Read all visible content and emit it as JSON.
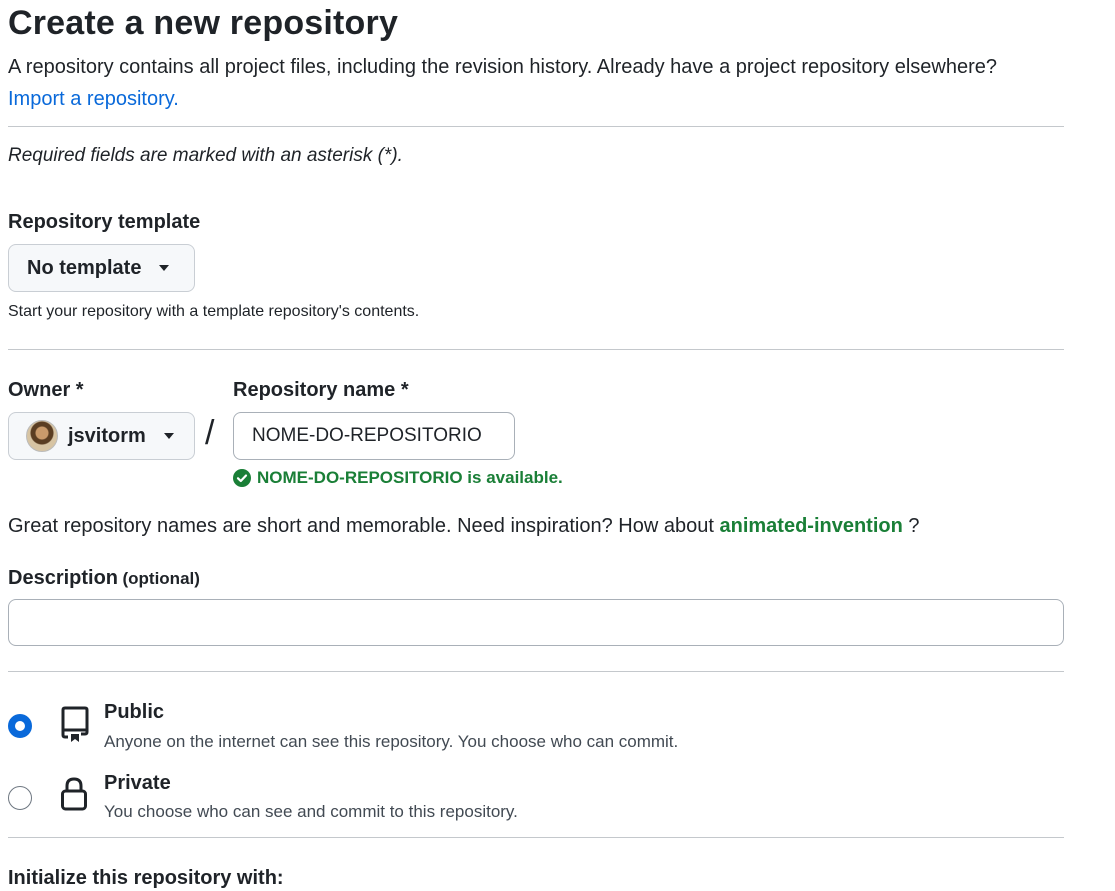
{
  "header": {
    "title": "Create a new repository",
    "description": "A repository contains all project files, including the revision history. Already have a project repository elsewhere?",
    "import_link": "Import a repository."
  },
  "required_note": "Required fields are marked with an asterisk (*).",
  "template": {
    "label": "Repository template",
    "selected": "No template",
    "help": "Start your repository with a template repository's contents."
  },
  "owner": {
    "label": "Owner *",
    "name": "jsvitorm"
  },
  "separator": "/",
  "repo_name": {
    "label": "Repository name *",
    "value": "NOME-DO-REPOSITORIO",
    "availability": "NOME-DO-REPOSITORIO is available.",
    "availability_color": "#1a7f37"
  },
  "suggestion": {
    "prefix": "Great repository names are short and memorable. Need inspiration? How about",
    "name": "animated-invention",
    "suffix": "?"
  },
  "description": {
    "label": "Description",
    "optional": "(optional)",
    "value": ""
  },
  "visibility": {
    "public": {
      "title": "Public",
      "desc": "Anyone on the internet can see this repository. You choose who can commit.",
      "icon": "repo-icon",
      "selected": true
    },
    "private": {
      "title": "Private",
      "desc": "You choose who can see and commit to this repository.",
      "icon": "lock-icon",
      "selected": false
    }
  },
  "initialize": {
    "label": "Initialize this repository with:"
  },
  "colors": {
    "link": "#0969da",
    "success": "#1a7f37",
    "accent": "#0969da"
  }
}
